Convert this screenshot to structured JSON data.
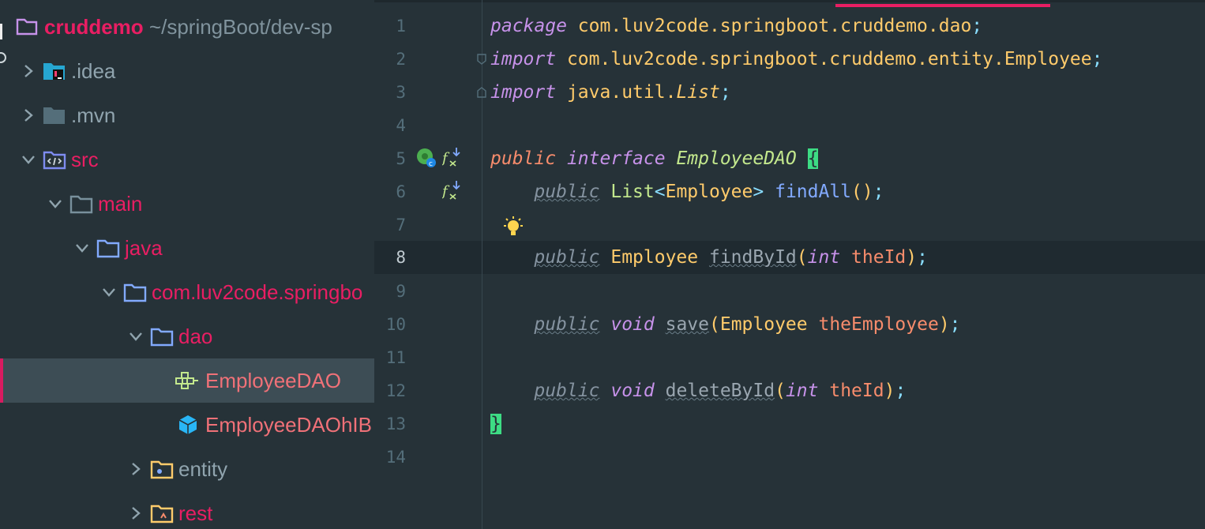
{
  "project": {
    "name": "cruddemo",
    "path": "~/springBoot/dev-sp"
  },
  "tree": [
    {
      "label": ".idea",
      "depth": 1,
      "expanded": false,
      "icon": "idea-folder-icon",
      "color": "#90a4ae"
    },
    {
      "label": ".mvn",
      "depth": 1,
      "expanded": false,
      "icon": "folder-icon",
      "color": "#90a4ae"
    },
    {
      "label": "src",
      "depth": 1,
      "expanded": true,
      "icon": "source-folder-icon",
      "color": "#e91e63"
    },
    {
      "label": "main",
      "depth": 2,
      "expanded": true,
      "icon": "folder-icon",
      "color": "#e91e63"
    },
    {
      "label": "java",
      "depth": 3,
      "expanded": true,
      "icon": "source-root-folder-icon",
      "color": "#e91e63"
    },
    {
      "label": "com.luv2code.springbo",
      "depth": 4,
      "expanded": true,
      "icon": "package-folder-icon",
      "color": "#e91e63"
    },
    {
      "label": "dao",
      "depth": 5,
      "expanded": true,
      "icon": "package-folder-icon",
      "color": "#e91e63"
    },
    {
      "label": "EmployeeDAO",
      "depth": 6,
      "icon": "interface-icon",
      "color": "#f07178",
      "selected": true
    },
    {
      "label": "EmployeeDAOhIB",
      "depth": 6,
      "icon": "class-cube-icon",
      "color": "#f07178"
    },
    {
      "label": "entity",
      "depth": 5,
      "expanded": false,
      "icon": "entity-folder-icon",
      "color": "#90a4ae"
    },
    {
      "label": "rest",
      "depth": 5,
      "expanded": false,
      "icon": "rest-folder-icon",
      "color": "#e91e63"
    }
  ],
  "editor": {
    "active_line": 8,
    "line_numbers": [
      "1",
      "2",
      "3",
      "4",
      "5",
      "6",
      "7",
      "8",
      "9",
      "10",
      "11",
      "12",
      "13",
      "14"
    ],
    "code": {
      "l1": {
        "kw": "package",
        "pkg": "com.luv2code.springboot.cruddemo.dao",
        "semi": ";"
      },
      "l2": {
        "kw": "import",
        "pkg": "com.luv2code.springboot.cruddemo.entity.Employee",
        "semi": ";"
      },
      "l3": {
        "kw": "import",
        "pkg": "java.util.",
        "cls": "List",
        "semi": ";"
      },
      "l5": {
        "kw1": "public",
        "kw2": "interface",
        "name": "EmployeeDAO",
        "brace": "{"
      },
      "l6": {
        "mod": "public",
        "type": "List",
        "lt": "<",
        "generic": "Employee",
        "gt": ">",
        "fn": "findAll",
        "parens": "()",
        "semi": ";"
      },
      "l8": {
        "mod": "public",
        "type": "Employee",
        "fn": "findById",
        "open": "(",
        "ptype": "int",
        "pname": "theId",
        "close": ")",
        "semi": ";"
      },
      "l10": {
        "mod": "public",
        "type": "void",
        "fn": "save",
        "open": "(",
        "ptype": "Employee",
        "pname": "theEmployee",
        "close": ")",
        "semi": ";"
      },
      "l12": {
        "mod": "public",
        "type": "void",
        "fn": "deleteById",
        "open": "(",
        "ptype": "int",
        "pname": "theId",
        "close": ")",
        "semi": ";"
      },
      "l13": {
        "brace": "}"
      }
    }
  },
  "colors": {
    "background": "#263238",
    "accent": "#e91e63",
    "selection": "#3d4d55",
    "brace_highlight": "#3ddc84"
  }
}
